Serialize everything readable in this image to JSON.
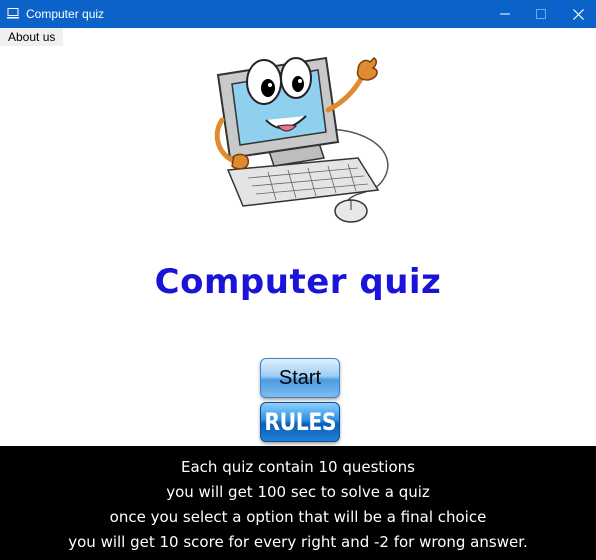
{
  "window": {
    "title": "Computer quiz",
    "controls": [
      "minimize-icon",
      "maximize-icon",
      "close-icon"
    ]
  },
  "menu": {
    "items": [
      {
        "label": "About us"
      }
    ]
  },
  "main": {
    "mascot_icon": "cartoon-computer-mascot",
    "heading": "Computer quiz",
    "heading_color": "#1a14d8",
    "start_button": "Start",
    "rules_button": "RULES"
  },
  "rules": {
    "lines": [
      "Each quiz contain 10 questions",
      "you will get 100 sec to solve a quiz",
      "once you select a option that will be a final choice",
      "you will get 10 score for every right  and -2 for wrong answer."
    ]
  },
  "colors": {
    "titlebar": "#0b63c9",
    "panel_bg": "#000000",
    "panel_text": "#ffffff"
  }
}
